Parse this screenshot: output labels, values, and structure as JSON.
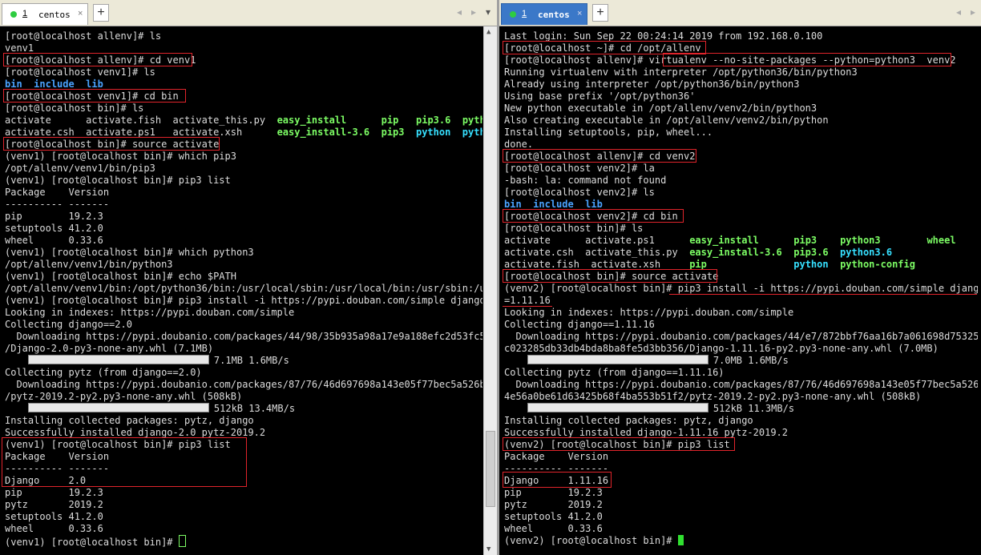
{
  "left_window": {
    "tab": {
      "number": "1",
      "label": "centos",
      "close": "×"
    },
    "add_tab": "+",
    "nav": {
      "prev": "◂",
      "next": "▸",
      "menu": "▾"
    },
    "lines": [
      {
        "t": "[root@localhost allenv]# ls"
      },
      {
        "t": "venv1",
        "c": "blue"
      },
      {
        "t": "[root@localhost allenv]# cd venv1"
      },
      {
        "t": "[root@localhost venv1]# ls"
      },
      {
        "segs": [
          {
            "t": "bin",
            "c": "blue"
          },
          {
            "t": "  "
          },
          {
            "t": "include",
            "c": "blue"
          },
          {
            "t": "  "
          },
          {
            "t": "lib",
            "c": "blue"
          }
        ]
      },
      {
        "t": "[root@localhost venv1]# cd bin"
      },
      {
        "t": "[root@localhost bin]# ls"
      },
      {
        "segs": [
          {
            "t": "activate      activate.fish  activate_this.py  "
          },
          {
            "t": "easy_install",
            "c": "green"
          },
          {
            "t": "      "
          },
          {
            "t": "pip",
            "c": "green"
          },
          {
            "t": "   "
          },
          {
            "t": "pip3.6",
            "c": "green"
          },
          {
            "t": "  "
          },
          {
            "t": "pytho",
            "c": "green"
          }
        ]
      },
      {
        "segs": [
          {
            "t": "activate.csh  activate.ps1   activate.xsh      "
          },
          {
            "t": "easy_install-3.6",
            "c": "green"
          },
          {
            "t": "  "
          },
          {
            "t": "pip3",
            "c": "green"
          },
          {
            "t": "  "
          },
          {
            "t": "python",
            "c": "cyan"
          },
          {
            "t": "  "
          },
          {
            "t": "pytho",
            "c": "cyan"
          }
        ]
      },
      {
        "t": "[root@localhost bin]# source activate"
      },
      {
        "t": "(venv1) [root@localhost bin]# which pip3"
      },
      {
        "t": "/opt/allenv/venv1/bin/pip3"
      },
      {
        "t": "(venv1) [root@localhost bin]# pip3 list"
      },
      {
        "t": "Package    Version"
      },
      {
        "t": "---------- -------"
      },
      {
        "t": "pip        19.2.3"
      },
      {
        "t": "setuptools 41.2.0"
      },
      {
        "t": "wheel      0.33.6"
      },
      {
        "t": "(venv1) [root@localhost bin]# which python3"
      },
      {
        "t": "/opt/allenv/venv1/bin/python3"
      },
      {
        "t": "(venv1) [root@localhost bin]# echo $PATH"
      },
      {
        "t": "/opt/allenv/venv1/bin:/opt/python36/bin:/usr/local/sbin:/usr/local/bin:/usr/sbin:/us"
      },
      {
        "t": "(venv1) [root@localhost bin]# pip3 install -i https://pypi.douban.com/simple django="
      },
      {
        "t": "Looking in indexes: https://pypi.douban.com/simple"
      },
      {
        "t": "Collecting django==2.0"
      },
      {
        "t": "  Downloading https://pypi.doubanio.com/packages/44/98/35b935a98a17e9a188efc2d53fc51"
      },
      {
        "t": "/Django-2.0-py3-none-any.whl (7.1MB)"
      },
      {
        "bar": "7.1MB 1.6MB/s"
      },
      {
        "t": "Collecting pytz (from django==2.0)"
      },
      {
        "t": "  Downloading https://pypi.doubanio.com/packages/87/76/46d697698a143e05f77bec5a526bf"
      },
      {
        "t": "/pytz-2019.2-py2.py3-none-any.whl (508kB)"
      },
      {
        "bar": "512kB 13.4MB/s"
      },
      {
        "t": "Installing collected packages: pytz, django"
      },
      {
        "t": "Successfully installed django-2.0 pytz-2019.2"
      },
      {
        "t": "(venv1) [root@localhost bin]# pip3 list"
      },
      {
        "t": "Package    Version"
      },
      {
        "t": "---------- -------"
      },
      {
        "t": "Django     2.0"
      },
      {
        "t": "pip        19.2.3"
      },
      {
        "t": "pytz       2019.2"
      },
      {
        "t": "setuptools 41.2.0"
      },
      {
        "t": "wheel      0.33.6"
      },
      {
        "t": "(venv1) [root@localhost bin]# ",
        "cursor": "box"
      }
    ]
  },
  "right_window": {
    "tab": {
      "number": "1",
      "label": "centos",
      "close": "×"
    },
    "add_tab": "+",
    "nav": {
      "prev": "◂",
      "next": "▸"
    },
    "lines": [
      {
        "t": "Last login: Sun Sep 22 00:24:14 2019 from 192.168.0.100"
      },
      {
        "t": "[root@localhost ~]# cd /opt/allenv"
      },
      {
        "t": "[root@localhost allenv]# virtualenv --no-site-packages --python=python3  venv2"
      },
      {
        "t": "Running virtualenv with interpreter /opt/python36/bin/python3"
      },
      {
        "t": "Already using interpreter /opt/python36/bin/python3"
      },
      {
        "t": "Using base prefix '/opt/python36'"
      },
      {
        "t": "New python executable in /opt/allenv/venv2/bin/python3"
      },
      {
        "t": "Also creating executable in /opt/allenv/venv2/bin/python"
      },
      {
        "t": "Installing setuptools, pip, wheel..."
      },
      {
        "t": "done."
      },
      {
        "t": "[root@localhost allenv]# cd venv2"
      },
      {
        "t": "[root@localhost venv2]# la"
      },
      {
        "t": "-bash: la: command not found"
      },
      {
        "t": "[root@localhost venv2]# ls"
      },
      {
        "segs": [
          {
            "t": "bin",
            "c": "blue"
          },
          {
            "t": "  "
          },
          {
            "t": "include",
            "c": "blue"
          },
          {
            "t": "  "
          },
          {
            "t": "lib",
            "c": "blue"
          }
        ]
      },
      {
        "t": "[root@localhost venv2]# cd bin"
      },
      {
        "t": "[root@localhost bin]# ls"
      },
      {
        "segs": [
          {
            "t": "activate      activate.ps1      "
          },
          {
            "t": "easy_install",
            "c": "green"
          },
          {
            "t": "      "
          },
          {
            "t": "pip3",
            "c": "green"
          },
          {
            "t": "    "
          },
          {
            "t": "python3",
            "c": "green"
          },
          {
            "t": "        "
          },
          {
            "t": "wheel",
            "c": "green"
          }
        ]
      },
      {
        "segs": [
          {
            "t": "activate.csh  activate_this.py  "
          },
          {
            "t": "easy_install-3.6",
            "c": "green"
          },
          {
            "t": "  "
          },
          {
            "t": "pip3.6",
            "c": "green"
          },
          {
            "t": "  "
          },
          {
            "t": "python3.6",
            "c": "cyan"
          }
        ]
      },
      {
        "segs": [
          {
            "t": "activate.fish  activate.xsh     "
          },
          {
            "t": "pip",
            "c": "green"
          },
          {
            "t": "               "
          },
          {
            "t": "python",
            "c": "cyan"
          },
          {
            "t": "  "
          },
          {
            "t": "python-config",
            "c": "green"
          }
        ]
      },
      {
        "t": "[root@localhost bin]# source activate"
      },
      {
        "t": "(venv2) [root@localhost bin]# pip3 install -i https://pypi.douban.com/simple django="
      },
      {
        "t": "=1.11.16"
      },
      {
        "t": "Looking in indexes: https://pypi.douban.com/simple"
      },
      {
        "t": "Collecting django==1.11.16"
      },
      {
        "t": "  Downloading https://pypi.doubanio.com/packages/44/e7/872bbf76aa16b7a061698d75325da"
      },
      {
        "t": "c023285db33db4bda8ba8fe5d3bb356/Django-1.11.16-py2.py3-none-any.whl (7.0MB)"
      },
      {
        "bar": "7.0MB 1.6MB/s"
      },
      {
        "t": "Collecting pytz (from django==1.11.16)"
      },
      {
        "t": "  Downloading https://pypi.doubanio.com/packages/87/76/46d697698a143e05f77bec5a526bf"
      },
      {
        "t": "4e56a0be61d63425b68f4ba553b51f2/pytz-2019.2-py2.py3-none-any.whl (508kB)"
      },
      {
        "bar": "512kB 11.3MB/s"
      },
      {
        "t": "Installing collected packages: pytz, django"
      },
      {
        "t": "Successfully installed django-1.11.16 pytz-2019.2"
      },
      {
        "t": "(venv2) [root@localhost bin]# pip3 list"
      },
      {
        "t": "Package    Version"
      },
      {
        "t": "---------- -------"
      },
      {
        "t": "Django     1.11.16"
      },
      {
        "t": "pip        19.2.3"
      },
      {
        "t": "pytz       2019.2"
      },
      {
        "t": "setuptools 41.2.0"
      },
      {
        "t": "wheel      0.33.6"
      },
      {
        "t": "(venv2) [root@localhost bin]# ",
        "cursor": "fill"
      }
    ]
  },
  "colors": {
    "annotation": "#e0242b",
    "terminal_bg": "#000000",
    "active_tab": "#3b78c8"
  }
}
